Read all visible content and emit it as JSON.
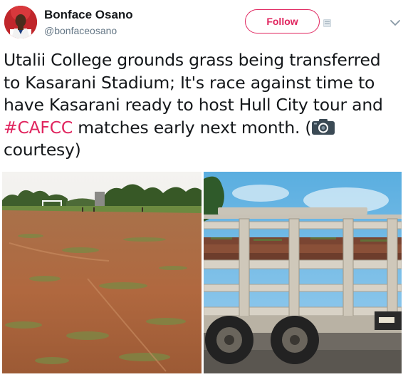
{
  "user": {
    "name": "Bonface Osano",
    "handle": "@bonfaceosano"
  },
  "follow_button": {
    "label": "Follow"
  },
  "tweet": {
    "lines": [
      "Utalii College grounds grass being transferred",
      "to Kasarani Stadium; It's race against time to",
      "have Kasarani ready to host Hull City tour and"
    ],
    "hashtag": "#CAFCC",
    "line4_after_hashtag": " matches early next month. (",
    "line5": "courtesy)"
  },
  "icons": {
    "camera": "camera-icon",
    "chevron": "chevron-down-icon",
    "card": "card-icon"
  },
  "colors": {
    "accent": "#e0245e",
    "text": "#14171a",
    "muted": "#657786"
  }
}
